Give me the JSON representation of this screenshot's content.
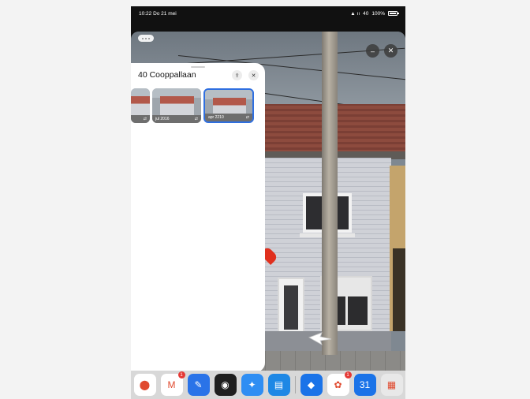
{
  "status_bar": {
    "time_date": "10:22 Do 21 mei",
    "signal": "40",
    "battery": "100%"
  },
  "street_view": {
    "pin_color": "#e0301e"
  },
  "panel": {
    "title": "40 Cooppallaan",
    "share_icon": "share-icon",
    "close_icon": "close-icon",
    "thumbnails": [
      {
        "label": ""
      },
      {
        "label": "jul 2016"
      },
      {
        "label": "apr 2210"
      }
    ]
  },
  "dock": {
    "apps": [
      {
        "name": "maps-app",
        "color": "#ffffff",
        "glyph": "⬤"
      },
      {
        "name": "gmail-app",
        "color": "#ffffff",
        "glyph": "M",
        "badge": "1"
      },
      {
        "name": "notes-app",
        "color": "#2a73e8",
        "glyph": "✎"
      },
      {
        "name": "camera-app",
        "color": "#1f1f1f",
        "glyph": "◉"
      },
      {
        "name": "safari-app",
        "color": "#2f8ef3",
        "glyph": "✦"
      },
      {
        "name": "files-app",
        "color": "#1e88e5",
        "glyph": "▤"
      },
      {
        "name": "outlook-app",
        "color": "#1a73e8",
        "glyph": "◆"
      },
      {
        "name": "photos-app",
        "color": "#ffffff",
        "glyph": "✿",
        "badge": "1"
      },
      {
        "name": "calendar-app",
        "color": "#1a73e8",
        "glyph": "31"
      },
      {
        "name": "folder-app",
        "color": "#e8e8e8",
        "glyph": "▦"
      }
    ]
  }
}
